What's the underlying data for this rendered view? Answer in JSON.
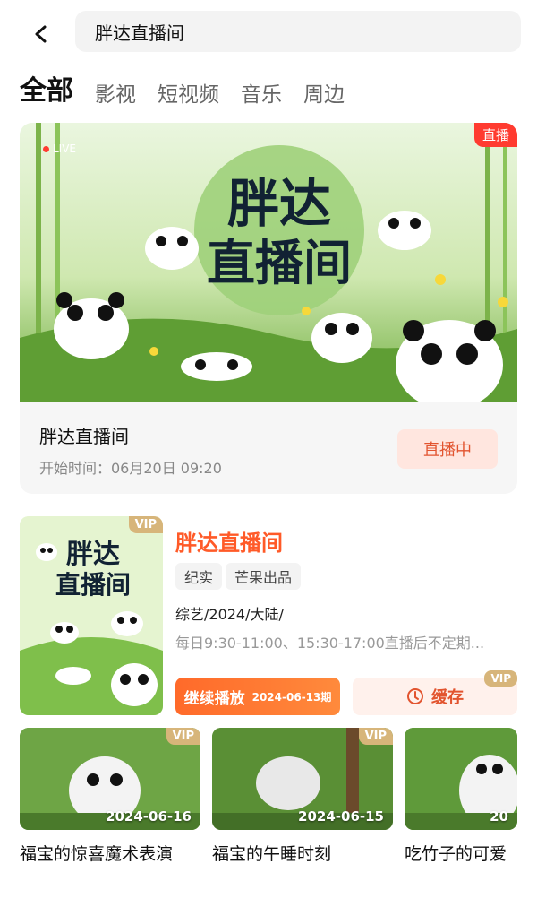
{
  "search": {
    "query": "胖达直播间"
  },
  "tabs": [
    {
      "label": "全部",
      "active": true
    },
    {
      "label": "影视"
    },
    {
      "label": "短视频"
    },
    {
      "label": "音乐"
    },
    {
      "label": "周边"
    }
  ],
  "live_card": {
    "badge": "直播",
    "live_indicator": "LIVE",
    "banner_title_line1": "胖达",
    "banner_title_line2": "直播间",
    "title": "胖达直播间",
    "start_time": "开始时间：06月20日 09:20",
    "status_button": "直播中"
  },
  "program": {
    "vip_badge": "VIP",
    "poster_title_line1": "胖达",
    "poster_title_line2": "直播间",
    "title": "胖达直播间",
    "tags": [
      "纪实",
      "芒果出品"
    ],
    "meta": "综艺/2024/大陆/",
    "schedule": "每日9:30-11:00、15:30-17:00直播后不定期...",
    "continue_label": "继续播放",
    "continue_episode": "2024-06-13期",
    "cache_label": "缓存",
    "cache_vip": "VIP"
  },
  "clips": [
    {
      "title": "福宝的惊喜魔术表演",
      "date": "2024-06-16",
      "vip": "VIP"
    },
    {
      "title": "福宝的午睡时刻",
      "date": "2024-06-15",
      "vip": "VIP"
    },
    {
      "title": "吃竹子的可爱",
      "date": "20",
      "vip": ""
    }
  ],
  "colors": {
    "accent": "#ff5a28",
    "live_badge": "#ff3b30",
    "vip_gold": "#d7b57a",
    "banner_green": "#7fbf4b"
  },
  "icons": {
    "back": "chevron-left-icon",
    "cache": "download-clock-icon"
  }
}
